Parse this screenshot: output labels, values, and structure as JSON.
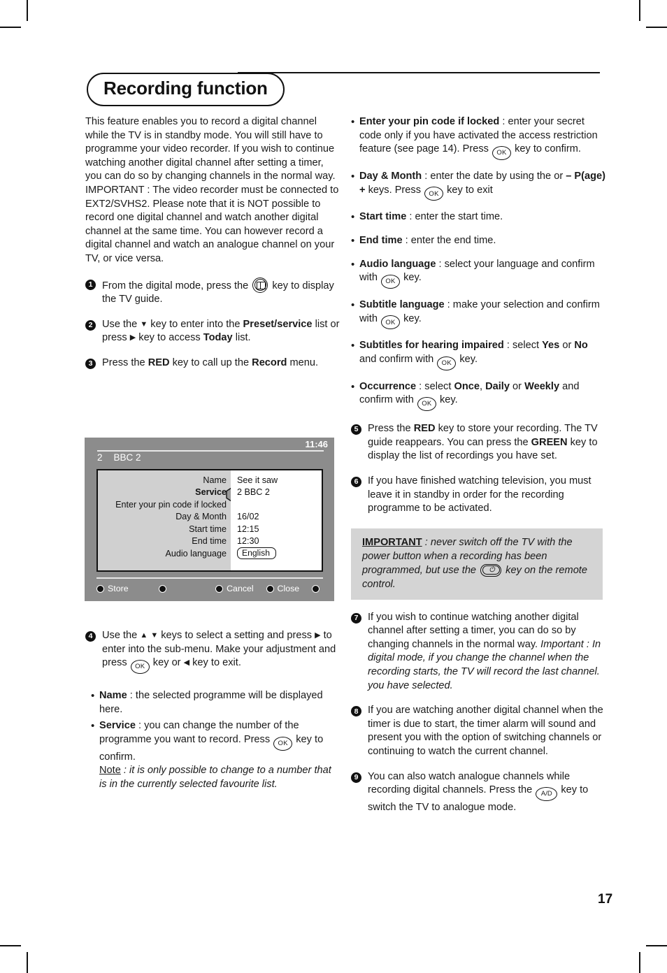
{
  "header": {
    "title": "Recording function"
  },
  "page_number": "17",
  "left_column": {
    "intro": "This feature enables you to record a digital channel while the TV is in standby mode. You will still have to programme your video recorder. If you wish to continue watching another digital channel after setting a timer, you can do so by changing channels in the normal way. IMPORTANT : The video recorder must be connected to EXT2/SVHS2. Please note that it is NOT possible to record one digital channel and watch another digital channel at the same time. You can however record a digital channel and watch an analogue channel on your TV, or vice versa.",
    "steps": [
      {
        "num": "1",
        "prefix": "From the digital mode, press the ",
        "icon": "tv-guide-icon",
        "suffix": " key to display the TV guide."
      },
      {
        "num": "2",
        "part1": "Use the ",
        "arrow1": "▼",
        "part2": " key to enter into the ",
        "bold1": "Preset/service",
        "part3": " list or press ",
        "arrow2": "▶",
        "part4": " key to access ",
        "bold2": "Today",
        "part5": " list."
      },
      {
        "num": "3",
        "part1": "Press the ",
        "bold1": "RED",
        "part2": " key to call up the ",
        "bold2": "Record",
        "part3": " menu."
      },
      {
        "num": "4",
        "part1": "Use the ",
        "arrow1": "▲",
        "arrow2": "▼",
        "part2": " keys to select a setting and press ",
        "arrow3": "▶",
        "part3": " to enter into the sub-menu. Make your adjustment and press ",
        "key1": "OK",
        "part4": " key or ",
        "arrow4": "◀",
        "part5": " key to exit."
      }
    ],
    "bullets": [
      {
        "label": "Name",
        "text": " : the selected programme will be displayed here."
      },
      {
        "label": "Service",
        "text1": " : you can change the number of the programme you want to record. Press ",
        "key": "OK",
        "text2": " key to confirm.",
        "note_label": "Note",
        "note_text": " : it is only possible to change to a number that is in the currently selected favourite list."
      }
    ]
  },
  "right_column": {
    "bullets": [
      {
        "label": "Enter your pin code if locked",
        "text1": " : enter your secret code only if you have activated the access restriction feature (see page 14). Press ",
        "key": "OK",
        "text2": " key to confirm."
      },
      {
        "label": "Day & Month",
        "text1": " : enter the date by using the or ",
        "bold1": "– P(age) +",
        "text2": " keys. Press ",
        "key": "OK",
        "text3": " key to exit"
      },
      {
        "label": "Start time",
        "text1": " : enter the start time."
      },
      {
        "label": "End time",
        "text1": " : enter the end time."
      },
      {
        "label": "Audio language",
        "text1": " : select your language and confirm with ",
        "key": "OK",
        "text2": " key."
      },
      {
        "label": "Subtitle language",
        "text1": " : make your selection and confirm with ",
        "key": "OK",
        "text2": " key."
      },
      {
        "label": "Subtitles for hearing impaired",
        "text1": " : select ",
        "bold1": "Yes",
        "text2": " or ",
        "bold2": "No",
        "text3": " and confirm with ",
        "key": "OK",
        "text4": " key."
      },
      {
        "label": "Occurrence",
        "text1": " : select ",
        "bold1": "Once",
        "text2": ", ",
        "bold2": "Daily",
        "text3": " or ",
        "bold3": "Weekly",
        "text4": " and confirm with ",
        "key": "OK",
        "text5": " key."
      }
    ],
    "steps": [
      {
        "num": "5",
        "part1": "Press the ",
        "bold1": "RED",
        "part2": " key to store your recording. The TV guide reappears. You can press the ",
        "bold2": "GREEN",
        "part3": " key to display the list of recordings you have set."
      },
      {
        "num": "6",
        "part1": "If you have finished watching television, you must leave it in standby in order for the recording programme to be activated."
      },
      {
        "num": "7",
        "part1": "If you wish to continue watching another digital channel after setting a timer, you can do so by changing channels in the normal way. ",
        "italic1": "Important : In digital mode, if you change the channel when the recording starts, the TV will record the last channel. you have selected."
      },
      {
        "num": "8",
        "part1": "If you are watching another digital channel when the timer is due to start, the timer alarm will sound and present you with the option of switching channels or continuing to watch the current channel."
      },
      {
        "num": "9",
        "part1": "You can also watch analogue channels while recording digital channels. Press the ",
        "key": "A/D",
        "part2": " key to switch the TV to analogue mode."
      }
    ],
    "important_box": {
      "header": "IMPORTANT",
      "text1": " : never switch off the TV with the power button when a recording has been programmed, but use the ",
      "icon": "power-icon",
      "text2": " key on the remote control."
    }
  },
  "tv_mockup": {
    "clock": "11:46",
    "channel_number": "2",
    "channel_name": "BBC 2",
    "rows": [
      {
        "label": "Name",
        "value": "See it saw",
        "selected": false,
        "type": "text"
      },
      {
        "label": "Service",
        "value": "2 BBC 2",
        "selected": true,
        "type": "text"
      },
      {
        "label": "Enter your pin code if locked",
        "value": "",
        "selected": false,
        "type": "text"
      },
      {
        "label": "Day & Month",
        "value": "16/02",
        "selected": false,
        "type": "text"
      },
      {
        "label": "Start time",
        "value": "12:15",
        "selected": false,
        "type": "text"
      },
      {
        "label": "End time",
        "value": "12:30",
        "selected": false,
        "type": "text"
      },
      {
        "label": "Audio language",
        "value": "English",
        "selected": false,
        "type": "pill"
      }
    ],
    "scroll_indicator": "▼",
    "bottom_bar": [
      {
        "label": "Store"
      },
      {
        "label": ""
      },
      {
        "label": "Cancel"
      },
      {
        "label": "Close"
      },
      {
        "label": ""
      }
    ]
  },
  "colors": {
    "tv_background": "#8c8c8c",
    "tv_panel_left": "#d0d0d0",
    "tv_panel_right": "#ffffff",
    "important_box": "#d4d4d4",
    "ink": "#1a1a1a"
  }
}
